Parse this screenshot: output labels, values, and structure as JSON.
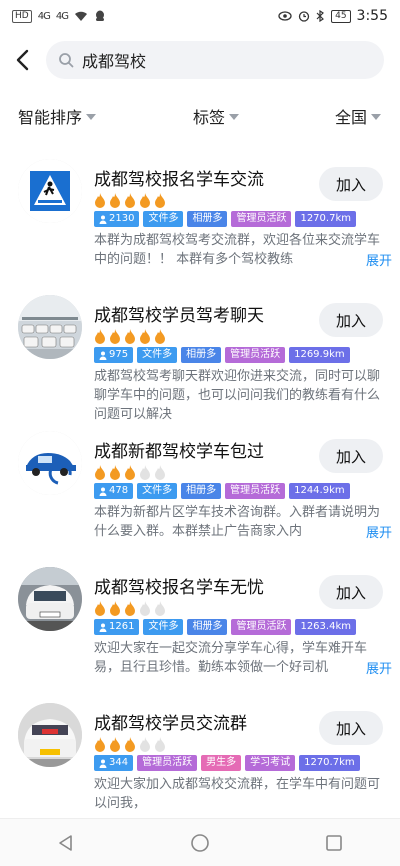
{
  "status_bar": {
    "left_chips": [
      "HD",
      "4G",
      "4G"
    ],
    "battery": "45",
    "time": "3:55"
  },
  "header": {
    "back_icon": "back-arrow-icon",
    "search_icon": "search-icon",
    "search_query": "成都驾校"
  },
  "filters": {
    "sort": "智能排序",
    "tags": "标签",
    "region": "全国"
  },
  "colors": {
    "member": "#3d9bf0",
    "files": "#3d9bf0",
    "album": "#4a85e8",
    "admin": "#b56bd8",
    "distance": "#6c6fe8",
    "gender": "#e56bb5",
    "study": "#b56bd8",
    "flame_on": "#f39a22",
    "flame_off": "#e2e2e2",
    "link": "#1f8ef1"
  },
  "groups": [
    {
      "title": "成都驾校报名学车交流",
      "join_label": "加入",
      "flames": 5,
      "tags": [
        {
          "text": "2130",
          "kind": "member"
        },
        {
          "text": "文件多",
          "kind": "files"
        },
        {
          "text": "相册多",
          "kind": "album"
        },
        {
          "text": "管理员活跃",
          "kind": "admin"
        },
        {
          "text": "1270.7km",
          "kind": "distance"
        }
      ],
      "desc": "本群为成都驾校驾考交流群，欢迎各位来交流学车中的问题！！ 本群有多个驾校教练",
      "expand": "展开"
    },
    {
      "title": "成都驾校学员驾考聊天",
      "join_label": "加入",
      "flames": 5,
      "tags": [
        {
          "text": "975",
          "kind": "member"
        },
        {
          "text": "文件多",
          "kind": "files"
        },
        {
          "text": "相册多",
          "kind": "album"
        },
        {
          "text": "管理员活跃",
          "kind": "admin"
        },
        {
          "text": "1269.9km",
          "kind": "distance"
        }
      ],
      "desc": "成都驾校驾考聊天群欢迎你进来交流，同时可以聊聊学车中的问题，也可以问问我们的教练看有什么问题可以解决",
      "expand": ""
    },
    {
      "title": "成都新都驾校学车包过",
      "join_label": "加入",
      "flames": 3,
      "tags": [
        {
          "text": "478",
          "kind": "member"
        },
        {
          "text": "文件多",
          "kind": "files"
        },
        {
          "text": "相册多",
          "kind": "album"
        },
        {
          "text": "管理员活跃",
          "kind": "admin"
        },
        {
          "text": "1244.9km",
          "kind": "distance"
        }
      ],
      "desc": "本群为新都片区学车技术咨询群。入群者请说明为什么要入群。本群禁止广告商家入内",
      "expand": "展开"
    },
    {
      "title": "成都驾校报名学车无忧",
      "join_label": "加入",
      "flames": 3,
      "tags": [
        {
          "text": "1261",
          "kind": "member"
        },
        {
          "text": "文件多",
          "kind": "files"
        },
        {
          "text": "相册多",
          "kind": "album"
        },
        {
          "text": "管理员活跃",
          "kind": "admin"
        },
        {
          "text": "1263.4km",
          "kind": "distance"
        }
      ],
      "desc": "欢迎大家在一起交流分享学车心得，学车难开车易，且行且珍惜。勤练本领做一个好司机",
      "expand": "展开"
    },
    {
      "title": "成都驾校学员交流群",
      "join_label": "加入",
      "flames": 3,
      "tags": [
        {
          "text": "344",
          "kind": "member"
        },
        {
          "text": "管理员活跃",
          "kind": "admin"
        },
        {
          "text": "男生多",
          "kind": "gender"
        },
        {
          "text": "学习考试",
          "kind": "study"
        },
        {
          "text": "1270.7km",
          "kind": "distance"
        }
      ],
      "desc": "欢迎大家加入成都驾校交流群，在学车中有问题可以问我，",
      "expand": ""
    }
  ]
}
